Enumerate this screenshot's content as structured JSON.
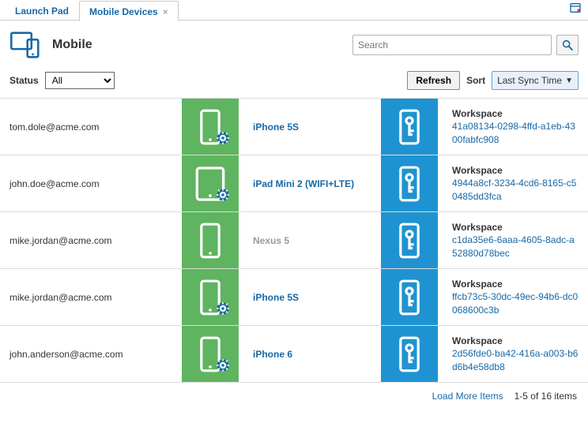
{
  "tabs": {
    "items": [
      {
        "label": "Launch Pad",
        "active": false,
        "closable": false
      },
      {
        "label": "Mobile Devices",
        "active": true,
        "closable": true
      }
    ]
  },
  "header": {
    "title": "Mobile",
    "search_placeholder": "Search"
  },
  "toolbar": {
    "status_label": "Status",
    "status_value": "All",
    "refresh_label": "Refresh",
    "sort_label": "Sort",
    "sort_value": "Last Sync Time"
  },
  "workspace_label": "Workspace",
  "rows": [
    {
      "email": "tom.dole@acme.com",
      "device": "iPhone 5S",
      "active": true,
      "workspace_id": "41a08134-0298-4ffd-a1eb-4300fabfc908"
    },
    {
      "email": "john.doe@acme.com",
      "device": "iPad Mini 2 (WIFI+LTE)",
      "active": true,
      "workspace_id": "4944a8cf-3234-4cd6-8165-c50485dd3fca"
    },
    {
      "email": "mike.jordan@acme.com",
      "device": "Nexus 5",
      "active": false,
      "workspace_id": "c1da35e6-6aaa-4605-8adc-a52880d78bec"
    },
    {
      "email": "mike.jordan@acme.com",
      "device": "iPhone 5S",
      "active": true,
      "workspace_id": "ffcb73c5-30dc-49ec-94b6-dc0068600c3b"
    },
    {
      "email": "john.anderson@acme.com",
      "device": "iPhone 6",
      "active": true,
      "workspace_id": "2d56fde0-ba42-416a-a003-b6d6b4e58db8"
    }
  ],
  "footer": {
    "load_more": "Load More Items",
    "range": "1-5 of 16 items"
  },
  "colors": {
    "link": "#1768a6",
    "device_tile": "#5fb45f",
    "workspace_tile": "#1f93d1"
  }
}
